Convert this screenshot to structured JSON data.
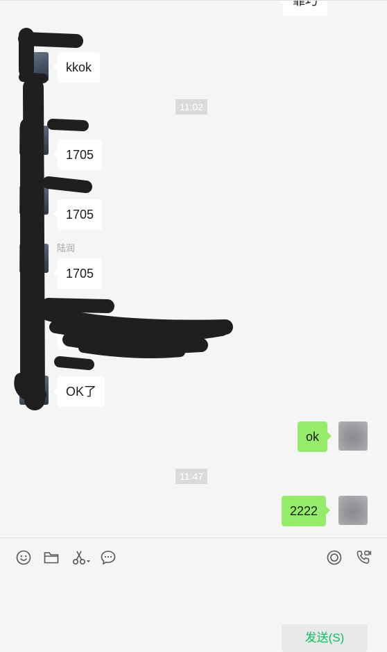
{
  "messages": [
    {
      "side": "out",
      "text": "靠巧"
    },
    {
      "side": "in",
      "text": "kkok"
    },
    {
      "side": "in",
      "text": "1705"
    },
    {
      "side": "in",
      "text": "1705"
    },
    {
      "side": "in",
      "text": "1705"
    },
    {
      "side": "in",
      "text": "OK了"
    },
    {
      "side": "out",
      "text": "ok"
    },
    {
      "side": "out",
      "text": "2222"
    }
  ],
  "timestamps": [
    "11:02",
    "11:47"
  ],
  "senders": [
    "陆润"
  ],
  "toolbar": {
    "icons": [
      "emoji-icon",
      "folder-icon",
      "scissors-icon",
      "chat-bubble-icon",
      "live-icon",
      "video-call-icon"
    ],
    "send_label": "发送(S)",
    "send_color": "#07c160"
  },
  "colors": {
    "outgoing_bubble": "#95ec69",
    "incoming_bubble": "#ffffff",
    "background": "#f5f5f5",
    "timestamp_bg": "#dadada"
  }
}
